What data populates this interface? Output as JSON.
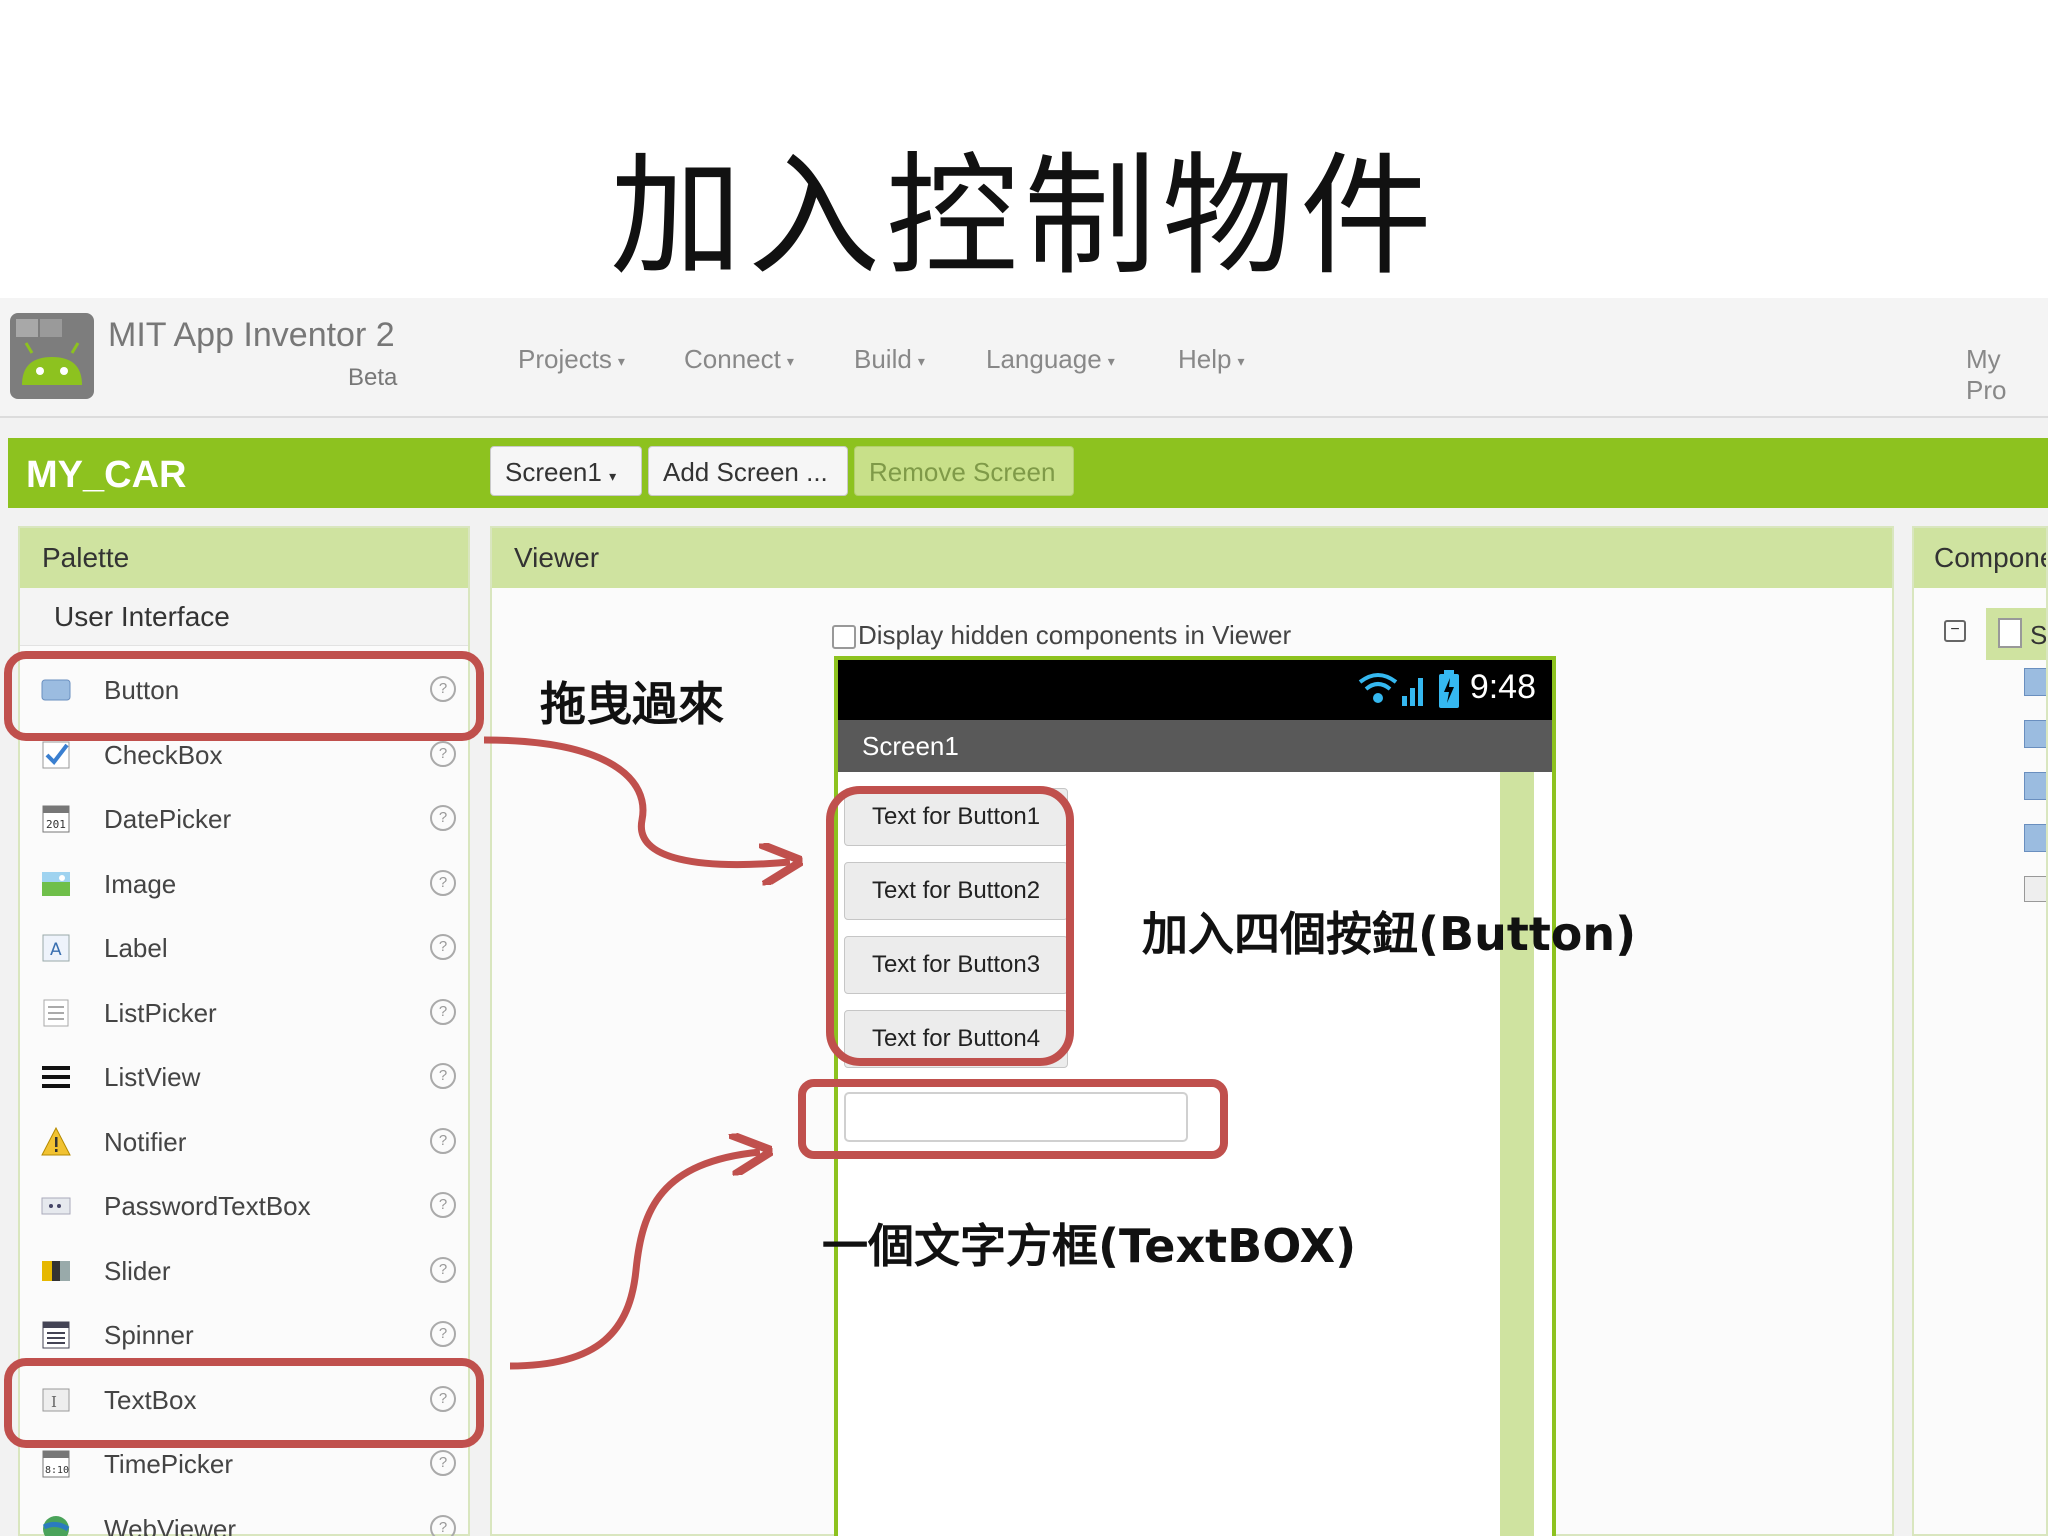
{
  "slide_title": "加入控制物件",
  "app": {
    "title": "MIT App Inventor 2",
    "subtitle": "Beta"
  },
  "menu": {
    "items": [
      "Projects",
      "Connect",
      "Build",
      "Language",
      "Help"
    ],
    "right": "My Pro"
  },
  "project": {
    "name": "MY_CAR",
    "screen_selector": "Screen1",
    "add_screen": "Add Screen ...",
    "remove_screen": "Remove Screen"
  },
  "palette": {
    "title": "Palette",
    "category": "User Interface",
    "help_glyph": "?",
    "items": [
      {
        "label": "Button",
        "icon": "button-icon"
      },
      {
        "label": "CheckBox",
        "icon": "checkbox-icon"
      },
      {
        "label": "DatePicker",
        "icon": "datepicker-icon"
      },
      {
        "label": "Image",
        "icon": "image-icon"
      },
      {
        "label": "Label",
        "icon": "label-icon"
      },
      {
        "label": "ListPicker",
        "icon": "listpicker-icon"
      },
      {
        "label": "ListView",
        "icon": "listview-icon"
      },
      {
        "label": "Notifier",
        "icon": "notifier-icon"
      },
      {
        "label": "PasswordTextBox",
        "icon": "passwordtextbox-icon"
      },
      {
        "label": "Slider",
        "icon": "slider-icon"
      },
      {
        "label": "Spinner",
        "icon": "spinner-icon"
      },
      {
        "label": "TextBox",
        "icon": "textbox-icon"
      },
      {
        "label": "TimePicker",
        "icon": "timepicker-icon"
      },
      {
        "label": "WebViewer",
        "icon": "webviewer-icon"
      }
    ]
  },
  "viewer": {
    "title": "Viewer",
    "hidden_checkbox_label": "Display hidden components in Viewer",
    "hidden_checkbox_checked": false,
    "phone": {
      "clock": "9:48",
      "screen_title": "Screen1",
      "buttons": [
        "Text for Button1",
        "Text for Button2",
        "Text for Button3",
        "Text for Button4"
      ],
      "textbox_value": ""
    }
  },
  "components": {
    "title": "Compone",
    "root": "Sc"
  },
  "annotations": {
    "drag": "拖曳過來",
    "four_buttons": "加入四個按鈕(Button)",
    "textbox": "一個文字方框(TextBOX)"
  },
  "colors": {
    "accent_green": "#8dc21f",
    "highlight_red": "#c0504d",
    "panel_green": "#cfe3a0"
  }
}
